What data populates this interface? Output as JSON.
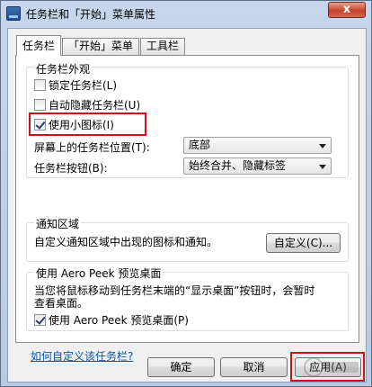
{
  "window": {
    "title": "任务栏和「开始」菜单属性",
    "close_label": "x"
  },
  "tabs": [
    {
      "label": "任务栏",
      "active": true
    },
    {
      "label": "「开始」菜单",
      "active": false
    },
    {
      "label": "工具栏",
      "active": false
    }
  ],
  "appearance": {
    "title": "任务栏外观",
    "lock_label": "锁定任务栏(L)",
    "lock_checked": false,
    "autohide_label": "自动隐藏任务栏(U)",
    "autohide_checked": false,
    "small_icons_label": "使用小图标(I)",
    "small_icons_checked": true,
    "location_label": "屏幕上的任务栏位置(T):",
    "location_value": "底部",
    "buttons_label": "任务栏按钮(B):",
    "buttons_value": "始终合并、隐藏标签"
  },
  "notification": {
    "title": "通知区域",
    "desc": "自定义通知区域中出现的图标和通知。",
    "customize_label": "自定义(C)..."
  },
  "peek": {
    "title": "使用 Aero Peek 预览桌面",
    "desc_line1": "当您将鼠标移动到任务栏末端的“显示桌面”按钮时，会暂时",
    "desc_line2": "查看桌面。",
    "checkbox_label": "使用 Aero Peek 预览桌面(P)",
    "checked": true
  },
  "help_link": "如何自定义该任务栏?",
  "footer": {
    "ok_label": "确定",
    "cancel_label": "取消",
    "apply_label": "应用(A)"
  },
  "colors": {
    "highlight": "#d3101a",
    "link": "#0a57a8"
  }
}
